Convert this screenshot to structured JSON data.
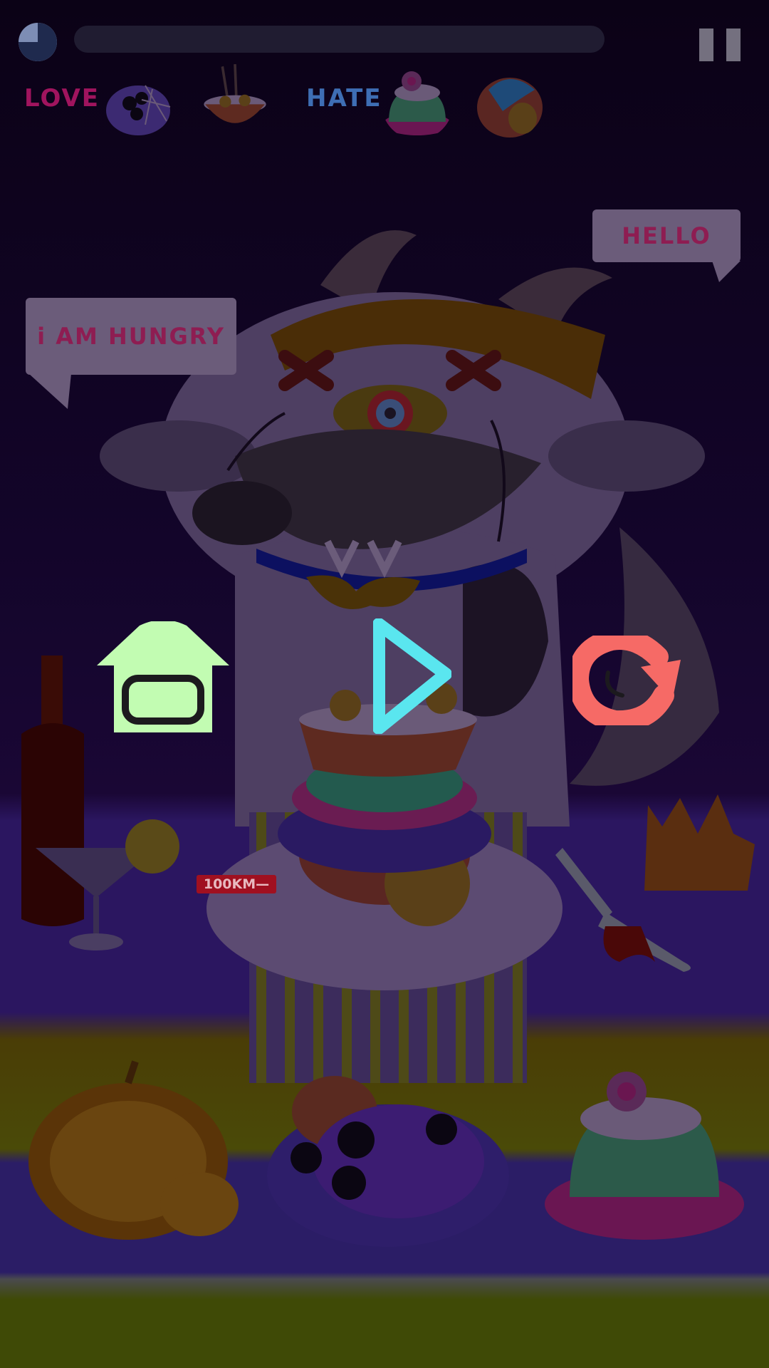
{
  "hud": {
    "timer_remaining_fraction": 0.25,
    "progress_fraction": 0.0,
    "pause_icon": "pause-icon"
  },
  "preferences": {
    "love_label": "LOVE",
    "hate_label": "HATE",
    "love_items": [
      "spider-web-dessert-icon",
      "noodle-bowl-icon"
    ],
    "hate_items": [
      "eyeball-cake-icon",
      "bloody-heart-icon"
    ]
  },
  "speech": {
    "hello": "HELLO",
    "hungry": "i AM HUNGRY"
  },
  "overlay_buttons": {
    "home_icon": "home-icon",
    "play_icon": "play-icon",
    "replay_icon": "replay-icon"
  },
  "table": {
    "badge_text": "100KM—"
  },
  "colors": {
    "home": "#c2fcb2",
    "play": "#5ae6ef",
    "replay": "#f66a66",
    "love": "#a0145e",
    "hate": "#3e6eb4"
  }
}
